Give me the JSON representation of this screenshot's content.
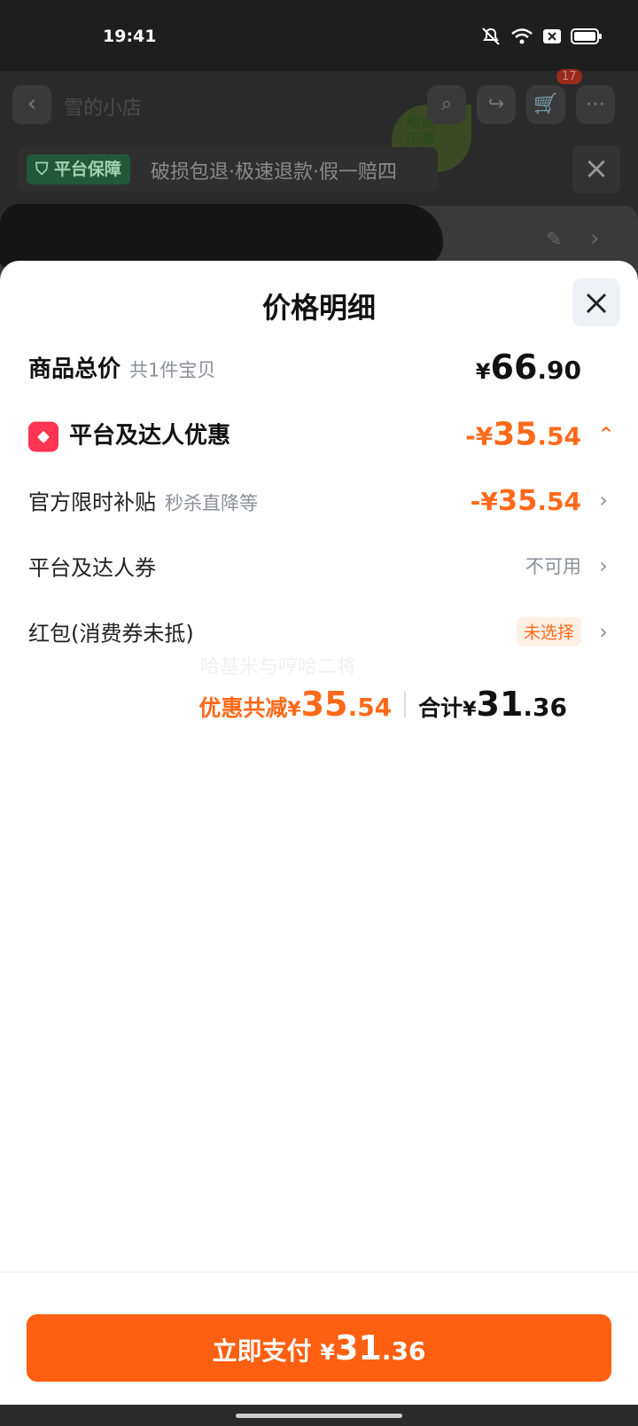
{
  "status_bar": {
    "time": "19:41",
    "icons": [
      "mute-icon",
      "wifi-icon",
      "sim-icon",
      "battery-icon"
    ]
  },
  "background_page": {
    "search_text": "雪的小店",
    "cart_badge": "17",
    "leaf_text_1": "电商",
    "leaf_text_2": "乐享",
    "guarantee_badge": "平台保障",
    "guarantee_text": "破损包退·极速退款·假一赔四"
  },
  "sheet": {
    "title": "价格明细",
    "product_total": {
      "label": "商品总价",
      "sub": "共1件宝贝",
      "yen": "¥",
      "int": "66",
      "dec": ".90"
    },
    "platform_discount": {
      "label": "平台及达人优惠",
      "prefix": "-¥",
      "int": "35",
      "dec": ".54"
    },
    "official_subsidy": {
      "label": "官方限时补贴",
      "sub": "秒杀直降等",
      "prefix": "-¥",
      "int": "35",
      "dec": ".54"
    },
    "coupon": {
      "label": "平台及达人券",
      "value": "不可用"
    },
    "red_packet": {
      "label": "红包(消费券未抵)",
      "value": "未选择"
    },
    "watermark": "哈基米与哼哈二将",
    "summary": {
      "discount_label": "优惠共减",
      "discount_yen": "¥",
      "discount_int": "35",
      "discount_dec": ".54",
      "total_label": "合计",
      "total_yen": "¥",
      "total_int": "31",
      "total_dec": ".36"
    }
  },
  "pay_button": {
    "label": "立即支付 ",
    "yen": "¥",
    "int": "31",
    "dec": ".36"
  },
  "colors": {
    "accent": "#ff6a1a",
    "pay_button": "#ff5f10",
    "tag_icon": "#ff3352",
    "guarantee_green": "#22583a"
  }
}
